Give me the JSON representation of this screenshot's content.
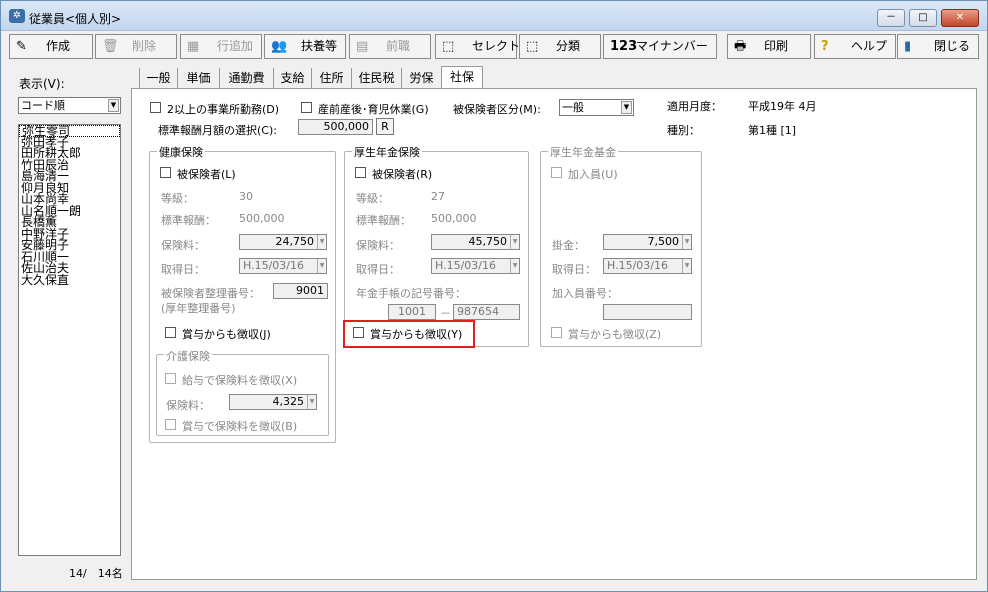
{
  "window": {
    "title": "従業員<個人別>",
    "buttons": {
      "min": "－",
      "max": "□",
      "close": "✕"
    }
  },
  "toolbar": [
    {
      "label": "作成",
      "icon": "✎",
      "disabled": false
    },
    {
      "label": "削除",
      "icon": "🗑",
      "disabled": true
    },
    {
      "label": "行追加",
      "icon": "▦",
      "disabled": true
    },
    {
      "label": "扶養等",
      "icon": "👥",
      "disabled": false
    },
    {
      "label": "前職",
      "icon": "▤",
      "disabled": true
    },
    {
      "label": "セレクト",
      "icon": "⬚",
      "disabled": false
    },
    {
      "label": "分類",
      "icon": "⬚",
      "disabled": false
    },
    {
      "label": "マイナンバー",
      "icon": "123",
      "disabled": false
    },
    {
      "label": "印刷",
      "icon": "🖶",
      "disabled": false
    },
    {
      "label": "ヘルプ",
      "icon": "?",
      "disabled": false
    },
    {
      "label": "閉じる",
      "icon": "▮",
      "disabled": false
    }
  ],
  "left": {
    "display_label": "表示(V):",
    "sort_value": "コード順",
    "employees": [
      "弥生零司",
      "弥田孝子",
      "田所耕太郎",
      "竹田辰治",
      "島海清一",
      "仰月良知",
      "山本尚幸",
      "山名順一朗",
      "長橋薫",
      "中野洋子",
      "安藤明子",
      "石川順一",
      "佐山治夫",
      "大久保直"
    ],
    "count": "14/　14名"
  },
  "tabs": [
    "一般",
    "単価",
    "通勤費",
    "支給",
    "住所",
    "住民税",
    "労保",
    "社保"
  ],
  "social": {
    "multi_office": "2以上の事業所勤務(D)",
    "maternity": "産前産後･育児休業(G)",
    "insured_type_label": "被保険者区分(M):",
    "insured_type_value": "一般",
    "apply_month_label": "適用月度：",
    "apply_month_value": "平成19年 4月",
    "kind_label": "種別：",
    "kind_value": "第1種 [1]",
    "standard_select_label": "標準報酬月額の選択(C):",
    "standard_select_value": "500,000",
    "r_button": "R",
    "health": {
      "title": "健康保険",
      "insured": "被保険者(L)",
      "grade_label": "等級：",
      "grade": "30",
      "std_label": "標準報酬：",
      "std": "500,000",
      "premium_label": "保険料：",
      "premium": "24,750",
      "acq_label": "取得日：",
      "acq": "H.15/03/16",
      "num_label": "被保険者整理番号：",
      "num_label2": "(厚年整理番号)",
      "num": "9001",
      "bonus": "賞与からも徴収(J)",
      "care": {
        "title": "介護保険",
        "salary": "給与で保険料を徴収(X)",
        "premium_label": "保険料：",
        "premium": "4,325",
        "bonus": "賞与で保険料を徴収(B)"
      }
    },
    "pension": {
      "title": "厚生年金保険",
      "insured": "被保険者(R)",
      "grade_label": "等級：",
      "grade": "27",
      "std_label": "標準報酬：",
      "std": "500,000",
      "premium_label": "保険料：",
      "premium": "45,750",
      "acq_label": "取得日：",
      "acq": "H.15/03/16",
      "book_label": "年金手帳の記号番号：",
      "book1": "1001",
      "dash": "－",
      "book2": "987654",
      "bonus": "賞与からも徴収(Y)"
    },
    "fund": {
      "title": "厚生年金基金",
      "member": "加入員(U)",
      "fee_label": "掛金：",
      "fee": "7,500",
      "acq_label": "取得日：",
      "acq": "H.15/03/16",
      "num_label": "加入員番号：",
      "num": "",
      "bonus": "賞与からも徴収(Z)"
    }
  },
  "colors": {
    "highlight": "#e02020",
    "title_bg": "#c3d6ee"
  }
}
